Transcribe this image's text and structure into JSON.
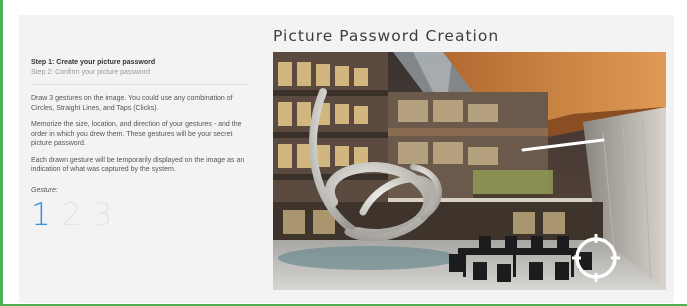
{
  "window": {
    "frame_color": "#4caf50",
    "panel_bg": "#f3f3f3"
  },
  "title": "Picture Password Creation",
  "steps": [
    {
      "label": "Step 1: Create your picture password",
      "state": "active"
    },
    {
      "label": "Step 2: Confirm your picture password",
      "state": "inactive"
    }
  ],
  "instructions": [
    "Draw 3 gestures on the image. You could use any combination of Circles, Straight Lines, and Taps (Clicks).",
    "Memorize the size, location, and direction of your gestures - and the order in which you drew them. These gestures will be your secret picture password.",
    "Each drawn gesture will be temporarily displayed on the image as an indication of what was captured by the system."
  ],
  "gesture": {
    "label": "Gesture:",
    "numbers": [
      "1",
      "2",
      "3"
    ],
    "current": 1,
    "active_color": "#3b8fd6",
    "inactive_color": "#dde6ee"
  },
  "picture": {
    "subject": "atrium-with-ribbon-sculpture",
    "tap_marker_icon": "tap-circle-icon",
    "tap_marker_color": "#ffffff"
  }
}
